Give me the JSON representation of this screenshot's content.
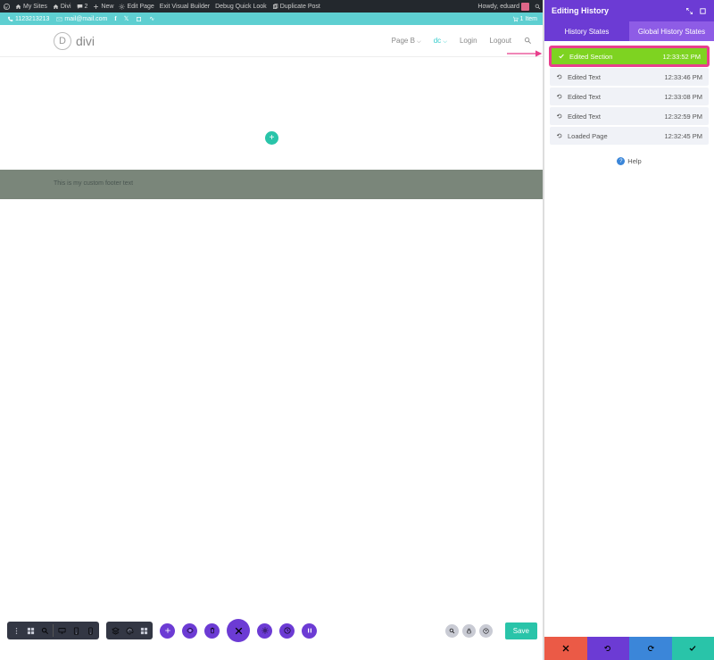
{
  "wp_bar": {
    "my_sites": "My Sites",
    "divi": "Divi",
    "comments": "2",
    "new": "New",
    "edit_page": "Edit Page",
    "exit_vb": "Exit Visual Builder",
    "debug": "Debug Quick Look",
    "duplicate": "Duplicate Post",
    "howdy": "Howdy, eduard"
  },
  "teal": {
    "phone": "1123213213",
    "email": "mail@mail.com",
    "cart": "1 Item"
  },
  "header": {
    "logo_letter": "D",
    "logo_text": "divi",
    "nav": {
      "page_b": "Page B",
      "dc": "dc",
      "login": "Login",
      "logout": "Logout"
    }
  },
  "canvas": {
    "footer_text": "This is my custom footer text",
    "add": "+"
  },
  "bottom": {
    "save": "Save"
  },
  "panel": {
    "title": "Editing History",
    "tab1": "History States",
    "tab2": "Global History States",
    "help": "Help"
  },
  "history": [
    {
      "label": "Edited Section",
      "time": "12:33:52 PM",
      "active": true,
      "icon": "check"
    },
    {
      "label": "Edited Text",
      "time": "12:33:46 PM",
      "icon": "undo"
    },
    {
      "label": "Edited Text",
      "time": "12:33:08 PM",
      "icon": "undo"
    },
    {
      "label": "Edited Text",
      "time": "12:32:59 PM",
      "icon": "undo"
    },
    {
      "label": "Loaded Page",
      "time": "12:32:45 PM",
      "icon": "undo"
    }
  ]
}
